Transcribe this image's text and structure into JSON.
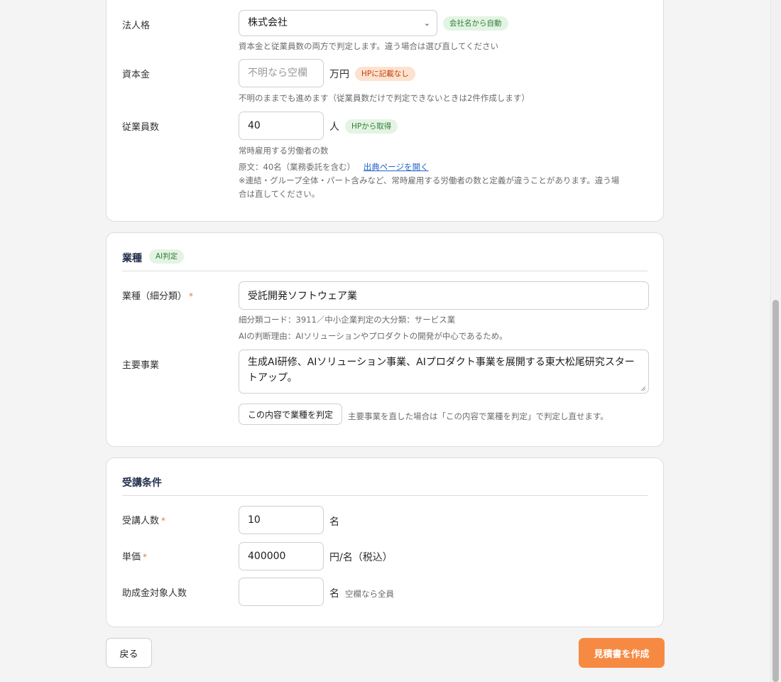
{
  "company": {
    "legal_form_label": "法人格",
    "legal_form_value": "株式会社",
    "legal_form_badge": "会社名から自動",
    "legal_form_hint": "資本金と従業員数の両方で判定します。違う場合は選び直してください",
    "capital_label": "資本金",
    "capital_placeholder": "不明なら空欄",
    "capital_unit": "万円",
    "capital_badge": "HPに記載なし",
    "capital_hint": "不明のままでも進めます（従業員数だけで判定できないときは2件作成します）",
    "employees_label": "従業員数",
    "employees_value": "40",
    "employees_unit": "人",
    "employees_badge": "HPから取得",
    "employees_hint": "常時雇用する労働者の数",
    "employees_source_text": "原文：40名（業務委託を含む）",
    "employees_source_link": "出典ページを開く",
    "employees_note_line1": "※連結・グループ全体・パート含みなど、常時雇用する労働者の数と定義が違うことがあります。違う場",
    "employees_note_line2": "合は直してください。"
  },
  "industry": {
    "title": "業種",
    "title_badge": "AI判定",
    "category_label": "業種（細分類）",
    "required_mark": "*",
    "category_value": "受託開発ソフトウェア業",
    "category_code_hint": "細分類コード：3911／中小企業判定の大分類：サービス業",
    "ai_reason_hint": "AIの判断理由：AIソリューションやプロダクトの開発が中心であるため。",
    "business_label": "主要事業",
    "business_value": "生成AI研修、AIソリューション事業、AIプロダクト事業を展開する東大松尾研究スタートアップ。",
    "judge_button": "この内容で業種を判定",
    "judge_hint": "主要事業を直した場合は「この内容で業種を判定」で判定し直せます。"
  },
  "attendance": {
    "title": "受講条件",
    "count_label": "受講人数",
    "count_value": "10",
    "count_unit": "名",
    "price_label": "単価",
    "price_value": "400000",
    "price_unit": "円/名（税込）",
    "subsidy_label": "助成金対象人数",
    "subsidy_value": "",
    "subsidy_unit": "名",
    "subsidy_hint": "空欄なら全員"
  },
  "footer": {
    "back_button": "戻る",
    "create_button": "見積書を作成"
  },
  "colors": {
    "accent": "#f78a43",
    "required": "#ef7a2f",
    "link": "#2563c9",
    "badge_green_bg": "#e4f4e4",
    "badge_orange_bg": "#fde2cf"
  }
}
